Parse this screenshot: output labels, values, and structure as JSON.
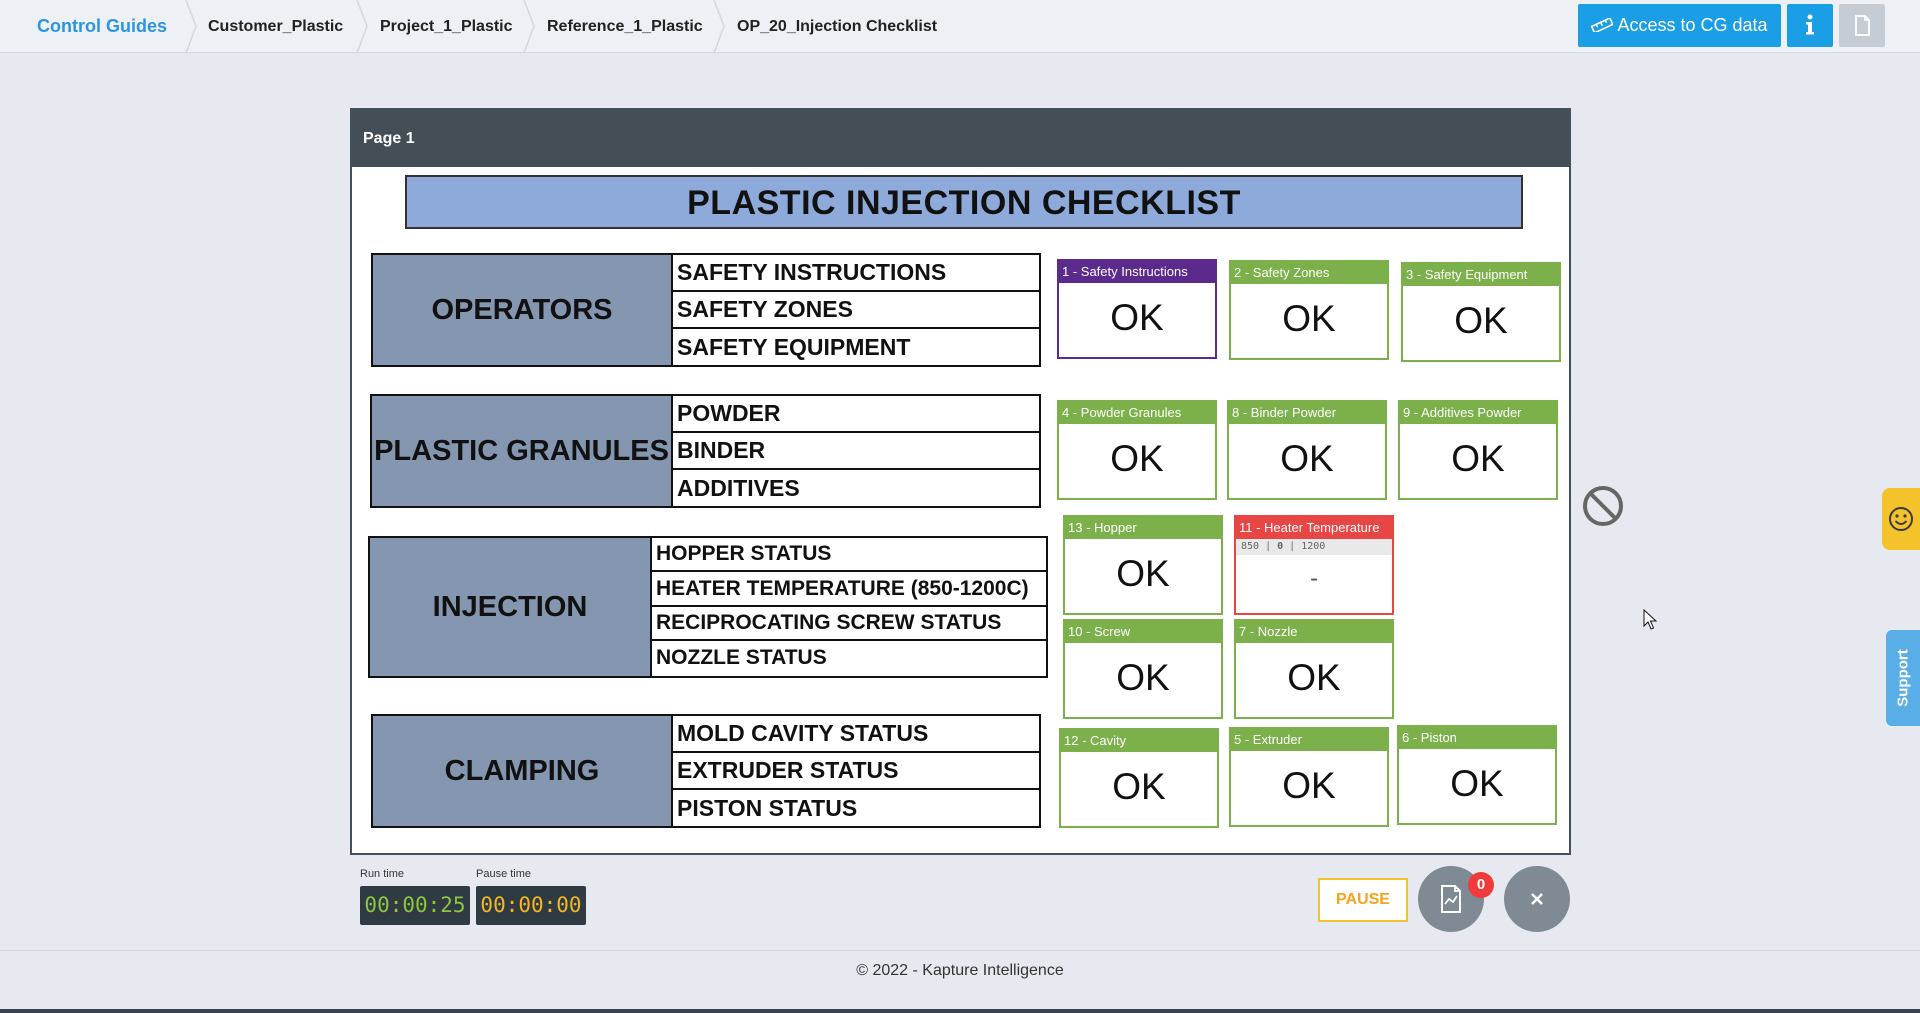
{
  "breadcrumb": {
    "items": [
      "Control Guides",
      "Customer_Plastic",
      "Project_1_Plastic",
      "Reference_1_Plastic",
      "OP_20_Injection Checklist"
    ]
  },
  "header_buttons": {
    "access_label": "Access to CG data",
    "info_icon": "info-icon",
    "doc_icon": "document-icon"
  },
  "document": {
    "page_label": "Page 1",
    "title": "PLASTIC INJECTION CHECKLIST",
    "sections": [
      {
        "name": "OPERATORS",
        "rows": [
          "SAFETY INSTRUCTIONS",
          "SAFETY ZONES",
          "SAFETY EQUIPMENT"
        ]
      },
      {
        "name": "PLASTIC GRANULES",
        "rows": [
          "POWDER",
          "BINDER",
          "ADDITIVES"
        ]
      },
      {
        "name": "INJECTION",
        "rows": [
          "HOPPER STATUS",
          "HEATER TEMPERATURE (850-1200C)",
          "RECIPROCATING SCREW STATUS",
          "NOZZLE STATUS"
        ]
      },
      {
        "name": "CLAMPING",
        "rows": [
          "MOLD CAVITY STATUS",
          "EXTRUDER STATUS",
          "PISTON STATUS"
        ]
      }
    ]
  },
  "checks": [
    {
      "label": "1 - Safety Instructions",
      "value": "OK",
      "state": "active"
    },
    {
      "label": "2 - Safety Zones",
      "value": "OK",
      "state": "ok"
    },
    {
      "label": "3 - Safety Equipment",
      "value": "OK",
      "state": "ok"
    },
    {
      "label": "4 - Powder Granules",
      "value": "OK",
      "state": "ok"
    },
    {
      "label": "8 - Binder Powder",
      "value": "OK",
      "state": "ok"
    },
    {
      "label": "9 - Additives Powder",
      "value": "OK",
      "state": "ok"
    },
    {
      "label": "13 - Hopper",
      "value": "OK",
      "state": "ok"
    },
    {
      "label": "11 - Heater Temperature",
      "value": "-",
      "state": "error",
      "range": {
        "min": "850",
        "nominal": "0",
        "max": "1200"
      }
    },
    {
      "label": "10 - Screw",
      "value": "OK",
      "state": "ok"
    },
    {
      "label": "7 - Nozzle",
      "value": "OK",
      "state": "ok"
    },
    {
      "label": "12 - Cavity",
      "value": "OK",
      "state": "ok"
    },
    {
      "label": "5 - Extruder",
      "value": "OK",
      "state": "ok"
    },
    {
      "label": "6 - Piston",
      "value": "OK",
      "state": "ok"
    }
  ],
  "timers": {
    "run_label": "Run time",
    "run_value": "00:00:25",
    "pause_label": "Pause time",
    "pause_value": "00:00:00"
  },
  "actions": {
    "pause_label": "PAUSE",
    "report_badge": "0"
  },
  "side_tabs": {
    "support_label": "Support"
  },
  "footer": {
    "copyright": "© 2022 - Kapture Intelligence"
  },
  "colors": {
    "accent": "#1a9ee6",
    "ok": "#7cb04a",
    "active": "#5b2a8c",
    "error": "#e84545",
    "section_head": "#8496b0",
    "title_bg": "#8eaadb"
  }
}
